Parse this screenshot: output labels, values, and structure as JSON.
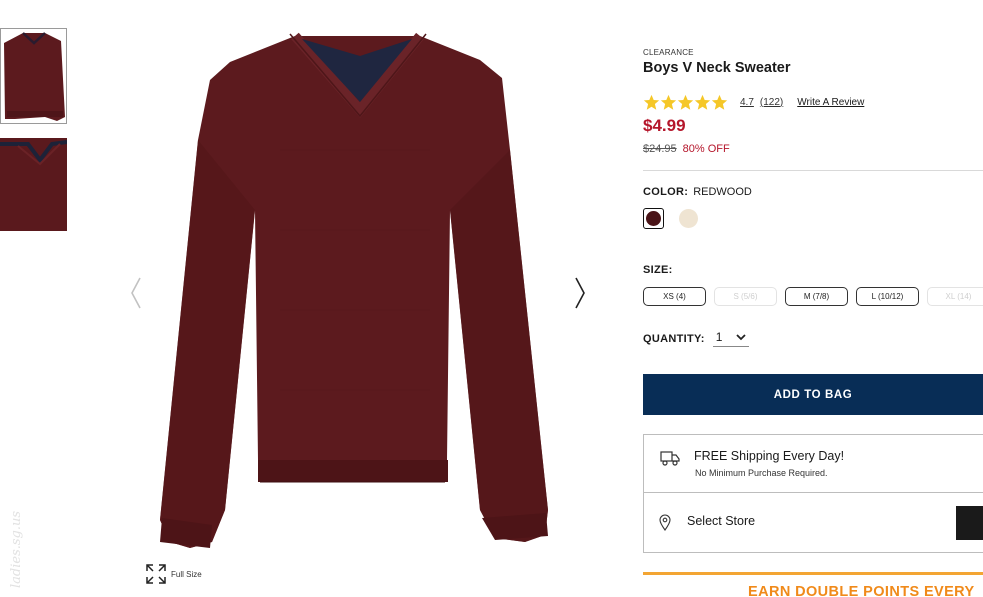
{
  "thumbnails": [
    {
      "alt": "sweater-front-thumbnail"
    },
    {
      "alt": "sweater-closeup-thumbnail"
    }
  ],
  "main_image": {
    "alt": "boys-v-neck-sweater"
  },
  "full_size_label": "Full Size",
  "product": {
    "tag": "CLEARANCE",
    "title": "Boys V Neck Sweater",
    "rating": "4.7",
    "review_count": "(122)",
    "write_review": "Write A Review",
    "stars": 5,
    "price": "$4.99",
    "original_price": "$24.95",
    "discount": "80% OFF"
  },
  "color": {
    "label": "COLOR:",
    "selected": "REDWOOD",
    "swatches": [
      {
        "name": "redwood",
        "hex": "#4a1418",
        "selected": true
      },
      {
        "name": "cream",
        "hex": "#efe4d2",
        "selected": false
      }
    ]
  },
  "size": {
    "label": "SIZE:",
    "options": [
      {
        "label": "XS (4)",
        "available": true
      },
      {
        "label": "S (5/6)",
        "available": false
      },
      {
        "label": "M (7/8)",
        "available": true
      },
      {
        "label": "L (10/12)",
        "available": true
      },
      {
        "label": "XL (14)",
        "available": false
      }
    ]
  },
  "quantity": {
    "label": "QUANTITY:",
    "value": "1"
  },
  "add_to_bag": "ADD TO BAG",
  "shipping": {
    "title": "FREE Shipping Every Day!",
    "subtitle": "No Minimum Purchase Required."
  },
  "store": {
    "label": "Select Store"
  },
  "promo": {
    "text": "EARN DOUBLE POINTS EVERY"
  },
  "colors": {
    "accent_red": "#b5162b",
    "button_navy": "#082d56",
    "promo_orange": "#f08a1a",
    "sweater": "#5c1a1e"
  }
}
